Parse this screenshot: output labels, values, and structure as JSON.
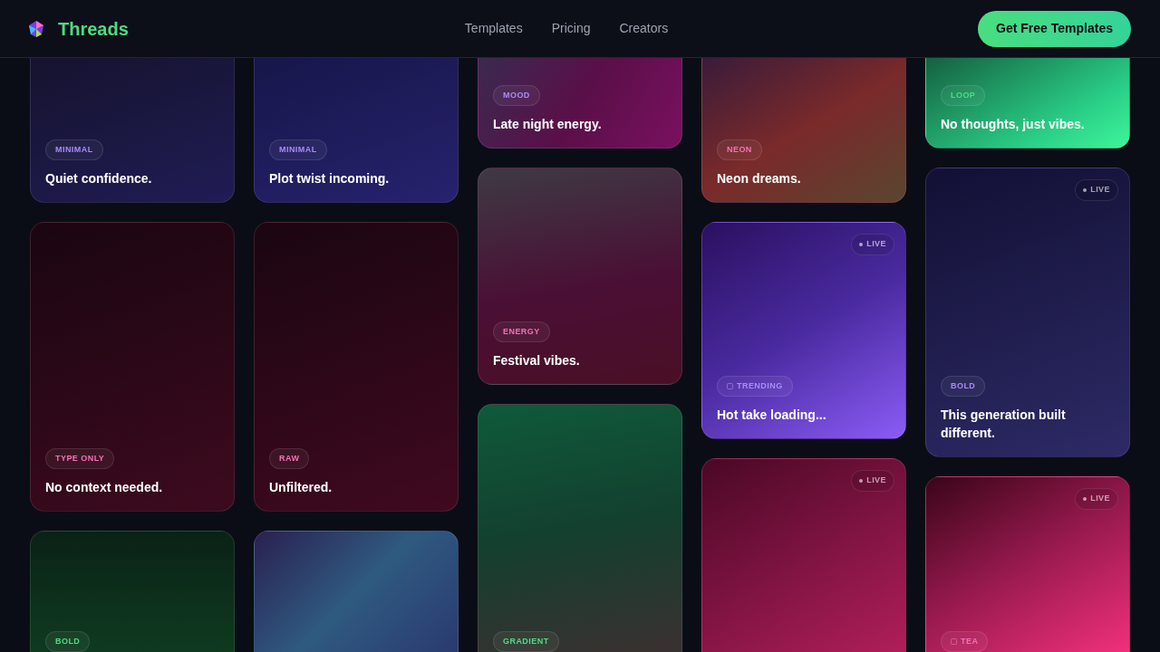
{
  "header": {
    "brand": "Threads",
    "nav": [
      "Templates",
      "Pricing",
      "Creators"
    ],
    "cta": "Get Free Templates"
  },
  "columns": [
    {
      "cards": [
        {
          "kind": "text",
          "tag": {
            "text": "MINIMAL",
            "color": "#a78bfa",
            "kind": "plain"
          },
          "title": "Quiet confidence."
        },
        {
          "kind": "text",
          "tag": {
            "text": "TYPE ONLY",
            "color": "#f472b6",
            "kind": "plain"
          },
          "title": "No context needed."
        },
        {
          "kind": "text",
          "tag": {
            "text": "BOLD",
            "color": "#4ade80",
            "kind": "plain"
          }
        }
      ]
    },
    {
      "cards": [
        {
          "kind": "text",
          "tag": {
            "text": "MINIMAL",
            "color": "#a78bfa",
            "kind": "plain"
          },
          "title": "Plot twist incoming."
        },
        {
          "kind": "text",
          "tag": {
            "text": "RAW",
            "color": "#f472b6",
            "kind": "plain"
          },
          "title": "Unfiltered."
        },
        {
          "kind": "blank"
        }
      ]
    },
    {
      "cards": [
        {
          "kind": "text",
          "tag": {
            "text": "MOOD",
            "color": "#a78bfa",
            "kind": "plain"
          },
          "title": "Late night energy."
        },
        {
          "kind": "text",
          "tag": {
            "text": "ENERGY",
            "color": "#f472b6",
            "kind": "plain"
          },
          "title": "Festival vibes."
        },
        {
          "kind": "text",
          "tag": {
            "text": "GRADIENT",
            "color": "#4ade80",
            "kind": "plain"
          }
        }
      ]
    },
    {
      "cards": [
        {
          "kind": "text",
          "tag": {
            "text": "NEON",
            "color": "#f472b6",
            "kind": "plain"
          },
          "title": "Neon dreams."
        },
        {
          "kind": "text",
          "badge": "LIVE",
          "tag": {
            "text": "TRENDING",
            "color": "#a78bfa",
            "kind": "icon"
          },
          "title": "Hot take loading..."
        },
        {
          "kind": "text",
          "badge": "LIVE"
        }
      ]
    },
    {
      "cards": [
        {
          "kind": "text",
          "tag": {
            "text": "LOOP",
            "color": "#4ade80",
            "kind": "plain"
          },
          "title": "No thoughts, just vibes."
        },
        {
          "kind": "text",
          "badge": "LIVE",
          "tag": {
            "text": "BOLD",
            "color": "#a78bfa",
            "kind": "plain"
          },
          "title": "This generation built different."
        },
        {
          "kind": "text",
          "badge": "LIVE",
          "tag": {
            "text": "TEA",
            "color": "#f472b6",
            "kind": "icon"
          }
        }
      ]
    }
  ]
}
